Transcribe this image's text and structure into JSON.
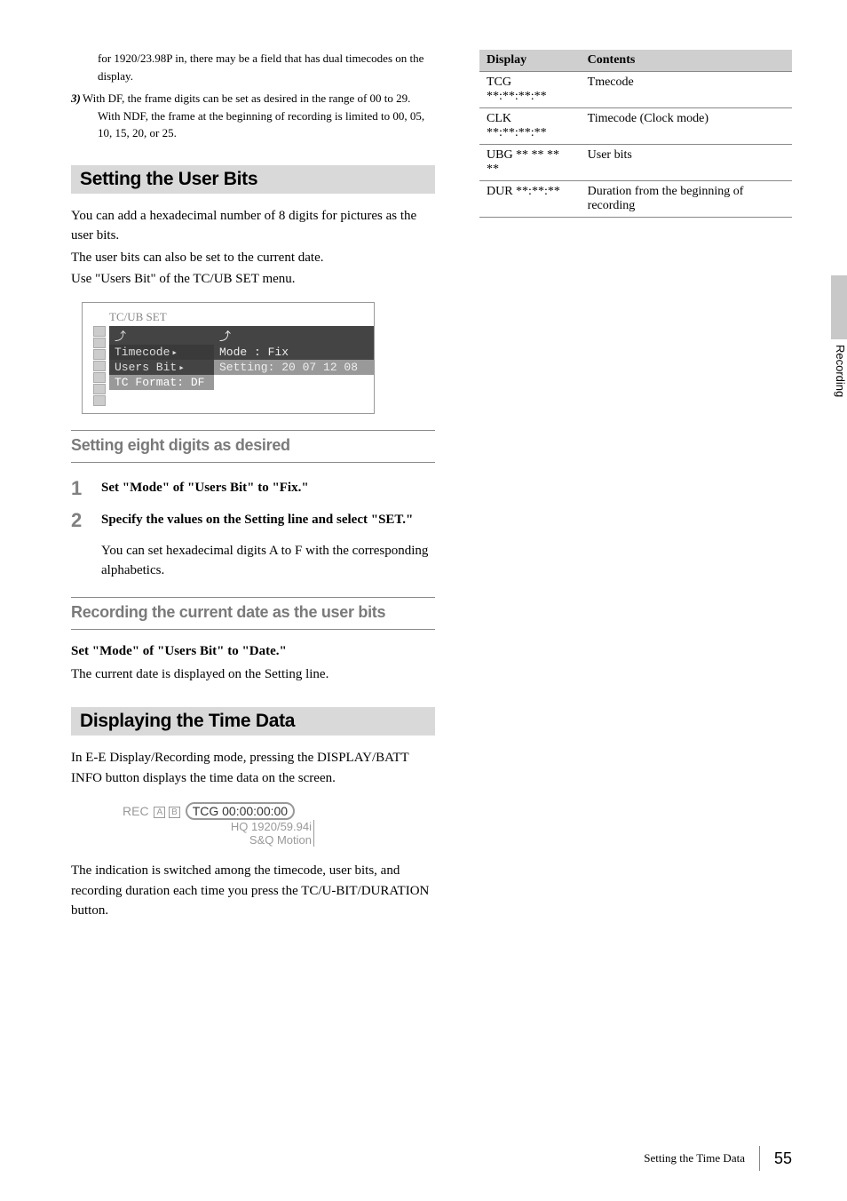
{
  "left": {
    "footnote_dual": "for 1920/23.98P in, there may be a field that has dual timecodes on the display.",
    "item3_label": "3)",
    "item3_line1": "With DF, the frame digits can be set as desired in the range of 00 to 29.",
    "item3_line2": "With NDF, the frame at the beginning of recording is limited to 00, 05, 10, 15, 20, or 25.",
    "section_user_bits": "Setting the User Bits",
    "ub_para1": "You can add a hexadecimal number of 8 digits for pictures as the user bits.",
    "ub_para2": "The user bits can also be set to the current date.",
    "ub_para3": "Use \"Users Bit\" of the TC/UB SET menu.",
    "menu": {
      "title": "TC/UB SET",
      "row_back": "⤴",
      "row_timecode": "Timecode",
      "row_users_bit": "Users Bit",
      "row_tc_format": "TC Format: DF",
      "right_back": "⤴",
      "right_mode": "Mode    : Fix",
      "right_setting": "Setting: 20 07 12 08"
    },
    "subsection_eight": "Setting eight digits as desired",
    "step1_num": "1",
    "step1_text": "Set \"Mode\" of \"Users Bit\" to \"Fix.\"",
    "step2_num": "2",
    "step2_text": "Specify the values on the Setting line and select \"SET.\"",
    "step2_extra": "You can set hexadecimal digits A to F with the corresponding alphabetics.",
    "subsection_date": "Recording the current date as the user bits",
    "date_bold": "Set \"Mode\" of \"Users Bit\" to \"Date.\"",
    "date_para": "The current date is displayed on the Setting line.",
    "section_display_time": "Displaying the Time Data",
    "dt_para1": "In E-E Display/Recording mode, pressing the DISPLAY/BATT INFO button displays the time data on the screen.",
    "rec_label": "REC",
    "rec_slot_a": "A",
    "rec_slot_b": "B",
    "rec_tcg": "TCG 00:00:00:00",
    "rec_sub1": "HQ 1920/59.94i",
    "rec_sub2": "S&Q Motion",
    "dt_para2": "The indication is switched among the timecode, user bits, and recording duration each time you press the TC/U-BIT/DURATION button."
  },
  "table": {
    "th_display": "Display",
    "th_contents": "Contents",
    "rows": [
      {
        "display": "TCG **:**:**:**",
        "contents": "Tmecode"
      },
      {
        "display": "CLK **:**:**:**",
        "contents": "Timecode (Clock mode)"
      },
      {
        "display": "UBG ** ** ** **",
        "contents": "User bits"
      },
      {
        "display": "DUR **:**:**",
        "contents": "Duration from the beginning of recording"
      }
    ]
  },
  "side_tab": "Recording",
  "footer_title": "Setting the Time Data",
  "footer_page": "55"
}
